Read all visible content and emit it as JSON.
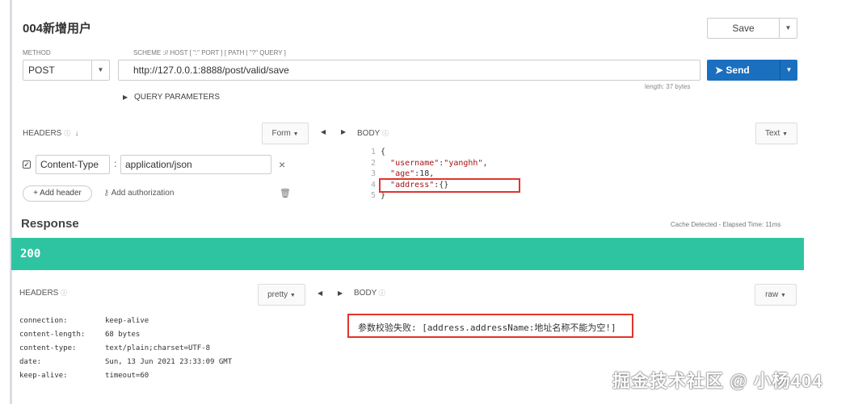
{
  "request": {
    "title": "004新增用户",
    "method_label": "METHOD",
    "scheme_label": "SCHEME :// HOST [ \":\" PORT ] [ PATH | \"?\" QUERY ]",
    "method": "POST",
    "url": "http://127.0.0.1:8888/post/valid/save",
    "save_label": "Save",
    "send_label": "Send",
    "length": "length: 37 bytes",
    "query_params_label": "QUERY PARAMETERS"
  },
  "req_headers": {
    "label": "HEADERS",
    "form_label": "Form",
    "rows": [
      {
        "name": "Content-Type",
        "separator": ":",
        "value": "application/json",
        "remove": "×"
      }
    ],
    "add_header": "+ Add header",
    "add_auth": "Add authorization"
  },
  "req_body": {
    "label": "BODY",
    "mode": "Text",
    "lines": [
      {
        "n": "1",
        "text": "{"
      },
      {
        "n": "2",
        "key": "\"username\"",
        "sep": ":",
        "val": "\"yanghh\"",
        "end": ","
      },
      {
        "n": "3",
        "key": "\"age\"",
        "sep": ":",
        "val": "18",
        "end": ","
      },
      {
        "n": "4",
        "key": "\"address\"",
        "sep": ":",
        "val": "{}",
        "end": ""
      },
      {
        "n": "5",
        "text": "}"
      }
    ]
  },
  "response": {
    "title": "Response",
    "cache": "Cache Detected - Elapsed Time: 11ms",
    "status": "200",
    "headers_label": "HEADERS",
    "headers_mode": "pretty",
    "body_label": "BODY",
    "body_mode": "raw",
    "headers": [
      {
        "k": "connection:",
        "v": "keep-alive"
      },
      {
        "k": "content-length:",
        "v": "68 bytes"
      },
      {
        "k": "content-type:",
        "v": "text/plain;charset=UTF-8"
      },
      {
        "k": "date:",
        "v": "Sun, 13 Jun 2021 23:33:09 GMT"
      },
      {
        "k": "keep-alive:",
        "v": "timeout=60"
      }
    ],
    "body": "参数校验失败: [address.addressName:地址名称不能为空!]"
  },
  "watermark": "掘金技术社区 @ 小杨404",
  "colors": {
    "accent": "#1a6fbf",
    "status_ok": "#2ec4a1",
    "highlight": "#e0352b"
  }
}
